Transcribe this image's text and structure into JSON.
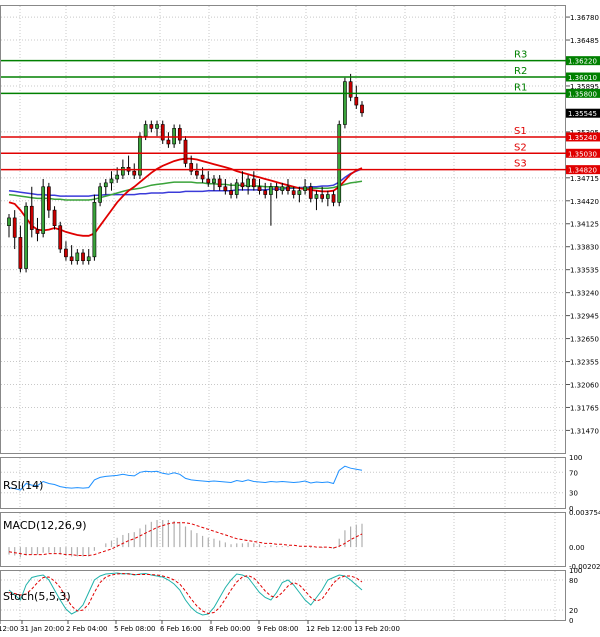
{
  "chart_data": {
    "type": "candlestick",
    "instrument_note": "",
    "price_axis": {
      "ylim": [
        1.3118,
        1.36935
      ],
      "tick_labels": [
        "1.36780",
        "1.36485",
        "1.35895",
        "1.35305",
        "1.34715",
        "1.34420",
        "1.34125",
        "1.33830",
        "1.33535",
        "1.33240",
        "1.32945",
        "1.32650",
        "1.32355",
        "1.32060",
        "1.31765",
        "1.31470"
      ],
      "price_tag": "1.35545",
      "level_tags": [
        "1.36220",
        "1.36010",
        "1.35800",
        "1.35240",
        "1.35030",
        "1.34820"
      ]
    },
    "x_axis": {
      "tick_labels": [
        "12:00",
        "31 Jan 20:00",
        "2 Feb 04:00",
        "5 Feb 08:00",
        "6 Feb 16:00",
        "8 Feb 00:00",
        "9 Feb 08:00",
        "12 Feb 12:00",
        "13 Feb 20:00"
      ]
    },
    "levels": [
      {
        "name": "R3",
        "value": 1.3622,
        "color": "#008000"
      },
      {
        "name": "R2",
        "value": 1.3601,
        "color": "#008000"
      },
      {
        "name": "R1",
        "value": 1.358,
        "color": "#008000"
      },
      {
        "name": "S1",
        "value": 1.3524,
        "color": "#e00000"
      },
      {
        "name": "S2",
        "value": 1.3503,
        "color": "#e00000"
      },
      {
        "name": "S3",
        "value": 1.3482,
        "color": "#e00000"
      }
    ],
    "candles": [
      [
        1.341,
        1.3425,
        1.3395,
        1.342
      ],
      [
        1.342,
        1.343,
        1.338,
        1.3395
      ],
      [
        1.3395,
        1.341,
        1.335,
        1.3355
      ],
      [
        1.3355,
        1.344,
        1.335,
        1.3435
      ],
      [
        1.3435,
        1.346,
        1.3395,
        1.3405
      ],
      [
        1.3405,
        1.342,
        1.339,
        1.34
      ],
      [
        1.34,
        1.347,
        1.3395,
        1.346
      ],
      [
        1.346,
        1.3465,
        1.342,
        1.343
      ],
      [
        1.343,
        1.3435,
        1.3405,
        1.341
      ],
      [
        1.341,
        1.3415,
        1.3375,
        1.338
      ],
      [
        1.338,
        1.339,
        1.3365,
        1.337
      ],
      [
        1.337,
        1.3385,
        1.336,
        1.3365
      ],
      [
        1.3365,
        1.338,
        1.336,
        1.3375
      ],
      [
        1.3375,
        1.338,
        1.336,
        1.3365
      ],
      [
        1.3365,
        1.338,
        1.336,
        1.337
      ],
      [
        1.337,
        1.345,
        1.3365,
        1.344
      ],
      [
        1.344,
        1.3465,
        1.3435,
        1.346
      ],
      [
        1.346,
        1.347,
        1.345,
        1.3465
      ],
      [
        1.3465,
        1.348,
        1.3455,
        1.347
      ],
      [
        1.347,
        1.3485,
        1.3465,
        1.3475
      ],
      [
        1.3475,
        1.3495,
        1.347,
        1.3485
      ],
      [
        1.3485,
        1.35,
        1.3475,
        1.348
      ],
      [
        1.348,
        1.349,
        1.347,
        1.3475
      ],
      [
        1.3475,
        1.353,
        1.347,
        1.3525
      ],
      [
        1.3525,
        1.3545,
        1.352,
        1.354
      ],
      [
        1.354,
        1.3545,
        1.353,
        1.3535
      ],
      [
        1.3535,
        1.3545,
        1.3525,
        1.354
      ],
      [
        1.354,
        1.3545,
        1.3515,
        1.352
      ],
      [
        1.352,
        1.353,
        1.351,
        1.3515
      ],
      [
        1.3515,
        1.354,
        1.351,
        1.3535
      ],
      [
        1.3535,
        1.354,
        1.3515,
        1.352
      ],
      [
        1.352,
        1.3525,
        1.3485,
        1.349
      ],
      [
        1.349,
        1.35,
        1.3475,
        1.348
      ],
      [
        1.348,
        1.349,
        1.347,
        1.3475
      ],
      [
        1.3475,
        1.3485,
        1.3465,
        1.347
      ],
      [
        1.347,
        1.348,
        1.346,
        1.3465
      ],
      [
        1.3465,
        1.3475,
        1.3455,
        1.347
      ],
      [
        1.347,
        1.3475,
        1.3455,
        1.346
      ],
      [
        1.346,
        1.347,
        1.345,
        1.3455
      ],
      [
        1.3455,
        1.3465,
        1.3445,
        1.345
      ],
      [
        1.345,
        1.347,
        1.3445,
        1.3465
      ],
      [
        1.3465,
        1.348,
        1.3455,
        1.346
      ],
      [
        1.346,
        1.3475,
        1.345,
        1.347
      ],
      [
        1.347,
        1.348,
        1.3455,
        1.346
      ],
      [
        1.346,
        1.347,
        1.345,
        1.3455
      ],
      [
        1.3455,
        1.3465,
        1.3445,
        1.345
      ],
      [
        1.345,
        1.3465,
        1.341,
        1.346
      ],
      [
        1.346,
        1.3465,
        1.3445,
        1.3455
      ],
      [
        1.3455,
        1.3465,
        1.345,
        1.346
      ],
      [
        1.346,
        1.347,
        1.345,
        1.3455
      ],
      [
        1.3455,
        1.346,
        1.3445,
        1.345
      ],
      [
        1.345,
        1.346,
        1.344,
        1.3455
      ],
      [
        1.3455,
        1.347,
        1.345,
        1.346
      ],
      [
        1.346,
        1.3465,
        1.344,
        1.3445
      ],
      [
        1.3445,
        1.3455,
        1.343,
        1.345
      ],
      [
        1.345,
        1.346,
        1.344,
        1.3445
      ],
      [
        1.3445,
        1.3455,
        1.3435,
        1.345
      ],
      [
        1.345,
        1.3455,
        1.3435,
        1.344
      ],
      [
        1.344,
        1.3545,
        1.3435,
        1.354
      ],
      [
        1.354,
        1.36,
        1.3535,
        1.3595
      ],
      [
        1.3595,
        1.3605,
        1.357,
        1.3575
      ],
      [
        1.3575,
        1.359,
        1.356,
        1.3565
      ],
      [
        1.3565,
        1.357,
        1.355,
        1.3555
      ]
    ],
    "ma_fast": [
      1.344,
      1.3438,
      1.343,
      1.342,
      1.341,
      1.3405,
      1.3404,
      1.3405,
      1.3407,
      1.3405,
      1.3402,
      1.34,
      1.3398,
      1.3397,
      1.3397,
      1.34,
      1.341,
      1.342,
      1.343,
      1.344,
      1.3448,
      1.3455,
      1.346,
      1.3466,
      1.3472,
      1.3478,
      1.3483,
      1.3487,
      1.349,
      1.3493,
      1.3495,
      1.3496,
      1.3496,
      1.3495,
      1.3493,
      1.3491,
      1.3489,
      1.3487,
      1.3485,
      1.3483,
      1.348,
      1.3478,
      1.3476,
      1.3474,
      1.3472,
      1.347,
      1.3468,
      1.3466,
      1.3464,
      1.3462,
      1.346,
      1.3458,
      1.3457,
      1.3456,
      1.3455,
      1.3454,
      1.3454,
      1.3455,
      1.346,
      1.3468,
      1.3476,
      1.3481,
      1.3484
    ],
    "ma_mid": [
      1.345,
      1.3449,
      1.3448,
      1.3447,
      1.3446,
      1.3445,
      1.3445,
      1.3445,
      1.3444,
      1.3444,
      1.3443,
      1.3443,
      1.3443,
      1.3443,
      1.3443,
      1.3444,
      1.3446,
      1.3448,
      1.345,
      1.3452,
      1.3454,
      1.3456,
      1.3457,
      1.3458,
      1.346,
      1.3462,
      1.3463,
      1.3464,
      1.3465,
      1.3466,
      1.3466,
      1.3466,
      1.3466,
      1.3465,
      1.3465,
      1.3464,
      1.3464,
      1.3463,
      1.3463,
      1.3462,
      1.3462,
      1.3462,
      1.3461,
      1.3461,
      1.3461,
      1.346,
      1.346,
      1.346,
      1.3459,
      1.3459,
      1.3459,
      1.3458,
      1.3458,
      1.3458,
      1.3458,
      1.3458,
      1.3458,
      1.3459,
      1.3461,
      1.3463,
      1.3465,
      1.3466,
      1.3467
    ],
    "ma_slow": [
      1.3455,
      1.3454,
      1.3453,
      1.3452,
      1.3451,
      1.345,
      1.345,
      1.3449,
      1.3449,
      1.3448,
      1.3448,
      1.3448,
      1.3448,
      1.3448,
      1.3448,
      1.3449,
      1.3449,
      1.345,
      1.345,
      1.345,
      1.345,
      1.345,
      1.345,
      1.3451,
      1.3451,
      1.3452,
      1.3452,
      1.3452,
      1.3453,
      1.3453,
      1.3453,
      1.3454,
      1.3454,
      1.3454,
      1.3454,
      1.3455,
      1.3455,
      1.3455,
      1.3455,
      1.3455,
      1.3456,
      1.3456,
      1.3456,
      1.3456,
      1.3456,
      1.3456,
      1.3457,
      1.3457,
      1.3457,
      1.3458,
      1.3458,
      1.3459,
      1.3459,
      1.346,
      1.346,
      1.3461,
      1.3461,
      1.3462,
      1.3466,
      1.3472,
      1.3477,
      1.348,
      1.3483
    ],
    "rsi": {
      "label": "RSI(14)",
      "ylim": [
        0,
        100
      ],
      "tick_labels": [
        "100",
        "70",
        "30",
        "0"
      ],
      "values": [
        40,
        38,
        35,
        48,
        45,
        44,
        52,
        48,
        46,
        42,
        40,
        39,
        40,
        39,
        40,
        55,
        60,
        62,
        63,
        64,
        66,
        64,
        63,
        70,
        72,
        71,
        72,
        68,
        66,
        69,
        66,
        58,
        55,
        54,
        53,
        52,
        53,
        52,
        51,
        50,
        54,
        52,
        55,
        52,
        51,
        50,
        52,
        51,
        52,
        51,
        50,
        51,
        53,
        49,
        51,
        50,
        51,
        48,
        74,
        82,
        78,
        76,
        74
      ]
    },
    "macd": {
      "label": "MACD(12,26,9)",
      "ylim": [
        -0.002021,
        0.003754
      ],
      "tick_labels": [
        "0.003754",
        "0.00",
        "-0.002021"
      ],
      "hist": [
        -0.0008,
        -0.0009,
        -0.0011,
        -0.0009,
        -0.0008,
        -0.0008,
        -0.0006,
        -0.0006,
        -0.0006,
        -0.0008,
        -0.0009,
        -0.001,
        -0.001,
        -0.001,
        -0.001,
        -0.0004,
        0.0,
        0.0004,
        0.0007,
        0.001,
        0.0013,
        0.0015,
        0.0016,
        0.002,
        0.0024,
        0.0027,
        0.0029,
        0.0029,
        0.0029,
        0.0028,
        0.0027,
        0.0022,
        0.0018,
        0.0015,
        0.0012,
        0.001,
        0.0009,
        0.0007,
        0.0005,
        0.0003,
        0.0004,
        0.0004,
        0.0005,
        0.0004,
        0.0003,
        0.0001,
        0.0002,
        0.0001,
        0.0001,
        0.0001,
        0.0,
        0.0,
        0.0001,
        -0.0001,
        0.0,
        -0.0001,
        0.0,
        -0.0002,
        0.0009,
        0.0018,
        0.0022,
        0.0024,
        0.0025
      ],
      "signal": [
        -0.0005,
        -0.0006,
        -0.0007,
        -0.0008,
        -0.0008,
        -0.0008,
        -0.0008,
        -0.0007,
        -0.0007,
        -0.0007,
        -0.0008,
        -0.0008,
        -0.0009,
        -0.0009,
        -0.0009,
        -0.0008,
        -0.0006,
        -0.0004,
        -0.0002,
        0.0001,
        0.0004,
        0.0007,
        0.0009,
        0.0012,
        0.0015,
        0.0018,
        0.0021,
        0.0023,
        0.0025,
        0.0026,
        0.0026,
        0.0026,
        0.0025,
        0.0023,
        0.0021,
        0.0019,
        0.0017,
        0.0015,
        0.0013,
        0.0011,
        0.0009,
        0.0008,
        0.0007,
        0.0006,
        0.0005,
        0.0004,
        0.0004,
        0.0003,
        0.0003,
        0.0002,
        0.0002,
        0.0001,
        0.0001,
        0.0001,
        0.0,
        0.0,
        0.0,
        -0.0001,
        0.0001,
        0.0004,
        0.0008,
        0.0011,
        0.0014
      ]
    },
    "stoch": {
      "label": "Stoch(5,5,3)",
      "ylim": [
        0,
        100
      ],
      "tick_labels": [
        "100",
        "80",
        "20",
        "0"
      ],
      "k": [
        60,
        50,
        40,
        70,
        85,
        88,
        90,
        80,
        60,
        40,
        22,
        12,
        18,
        30,
        55,
        80,
        88,
        92,
        93,
        94,
        92,
        93,
        90,
        92,
        93,
        90,
        88,
        86,
        80,
        72,
        60,
        40,
        25,
        15,
        10,
        12,
        25,
        45,
        65,
        80,
        92,
        90,
        85,
        70,
        55,
        45,
        40,
        55,
        75,
        80,
        70,
        55,
        40,
        30,
        45,
        60,
        80,
        85,
        90,
        88,
        80,
        70,
        60
      ],
      "d": [
        55,
        53,
        50,
        52,
        62,
        75,
        85,
        86,
        78,
        65,
        45,
        28,
        18,
        20,
        32,
        55,
        75,
        86,
        90,
        92,
        93,
        92,
        91,
        91,
        91,
        91,
        90,
        88,
        85,
        80,
        72,
        58,
        42,
        28,
        18,
        13,
        15,
        25,
        42,
        60,
        76,
        86,
        89,
        84,
        72,
        58,
        48,
        45,
        55,
        68,
        75,
        70,
        58,
        45,
        38,
        42,
        58,
        74,
        84,
        88,
        88,
        84,
        76
      ]
    }
  }
}
